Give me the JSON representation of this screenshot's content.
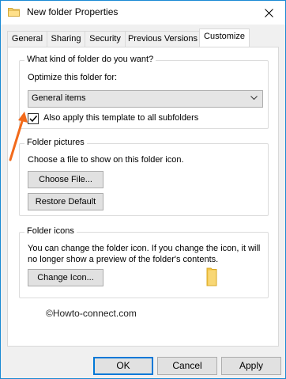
{
  "window": {
    "title": "New folder Properties"
  },
  "tabs": [
    {
      "label": "General"
    },
    {
      "label": "Sharing"
    },
    {
      "label": "Security"
    },
    {
      "label": "Previous Versions"
    },
    {
      "label": "Customize"
    }
  ],
  "customize": {
    "folder_type": {
      "legend": "What kind of folder do you want?",
      "optimize_label": "Optimize this folder for:",
      "selected_option": "General items",
      "apply_subfolders_label": "Also apply this template to all subfolders",
      "apply_subfolders_checked": true
    },
    "folder_pictures": {
      "legend": "Folder pictures",
      "description": "Choose a file to show on this folder icon.",
      "choose_file_label": "Choose File...",
      "restore_default_label": "Restore Default"
    },
    "folder_icons": {
      "legend": "Folder icons",
      "description_line1": "You can change the folder icon. If you change the icon, it will",
      "description_line2": "no longer show a preview of the folder's contents.",
      "change_icon_label": "Change Icon..."
    }
  },
  "watermark": "©Howto-connect.com",
  "footer": {
    "ok_label": "OK",
    "cancel_label": "Cancel",
    "apply_label": "Apply"
  },
  "colors": {
    "accent": "#0078d7",
    "annotation_arrow": "#f26a1b",
    "folder_yellow": "#f8d775"
  },
  "icons": {
    "title": "folder-icon",
    "close": "close-icon",
    "dropdown": "chevron-down-icon",
    "checkbox": "checkmark-icon",
    "annotation": "annotation-arrow-icon",
    "preview": "folder-icon"
  }
}
